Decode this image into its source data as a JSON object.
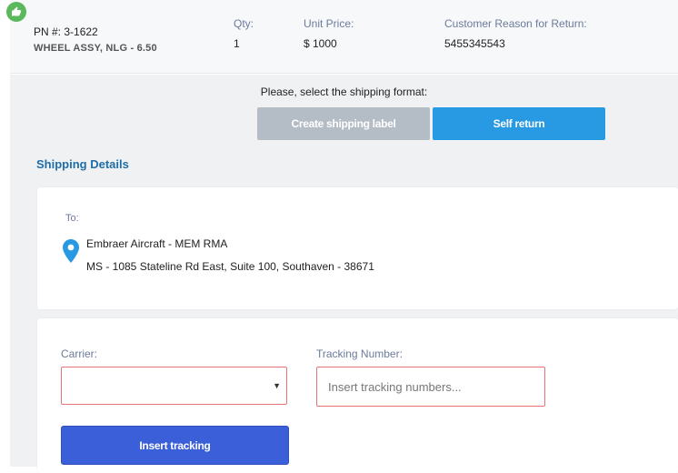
{
  "item": {
    "pn": "PN #: 3-1622",
    "description": "WHEEL ASSY, NLG - 6.50",
    "qty_label": "Qty:",
    "qty_value": "1",
    "unit_price_label": "Unit Price:",
    "unit_price_value": "$ 1000",
    "reason_label": "Customer Reason for Return:",
    "reason_value": "5455345543",
    "badge_icon": "thumbs-up-icon"
  },
  "shipping_format": {
    "prompt": "Please, select the shipping format:",
    "create_label": "Create shipping label",
    "self_return_label": "Self return"
  },
  "shipping_details": {
    "title": "Shipping Details",
    "to_label": "To:",
    "recipient": "Embraer Aircraft - MEM RMA",
    "address": "MS - 1085 Stateline Rd East, Suite 100, Southaven - 38671",
    "location_icon": "map-pin-icon"
  },
  "tracking": {
    "carrier_label": "Carrier:",
    "carrier_value": "",
    "tracking_label": "Tracking Number:",
    "tracking_placeholder": "Insert tracking numbers...",
    "tracking_value": "",
    "insert_button": "Insert tracking"
  },
  "colors": {
    "accent_blue": "#2899e3",
    "primary_button": "#3a5fd9",
    "disabled_button": "#b4bcc5",
    "error_border": "#e57373",
    "success_badge": "#5cb85c",
    "title_blue": "#1f6ea8"
  }
}
